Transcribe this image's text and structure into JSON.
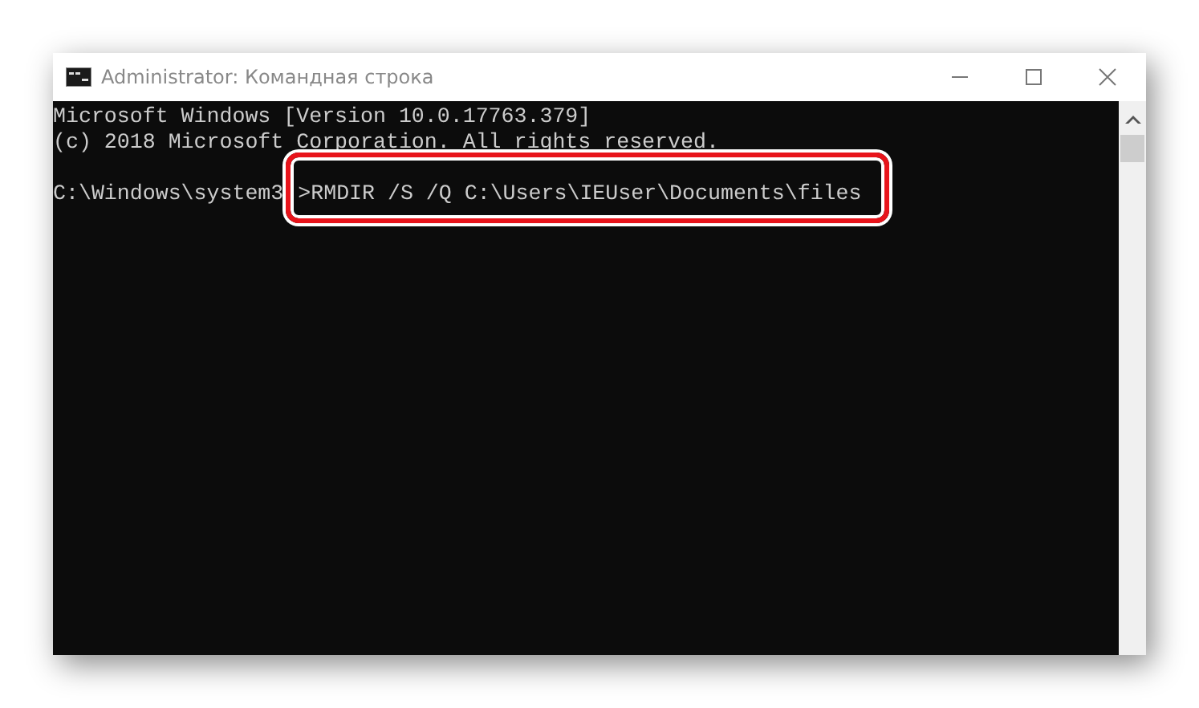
{
  "window": {
    "title": "Administrator: Командная строка"
  },
  "console": {
    "lines": [
      "Microsoft Windows [Version 10.0.17763.379]",
      "(c) 2018 Microsoft Corporation. All rights reserved."
    ],
    "prompt": "C:\\Windows\\system3",
    "command": ">RMDIR /S /Q C:\\Users\\IEUser\\Documents\\files",
    "highlighted": true
  }
}
